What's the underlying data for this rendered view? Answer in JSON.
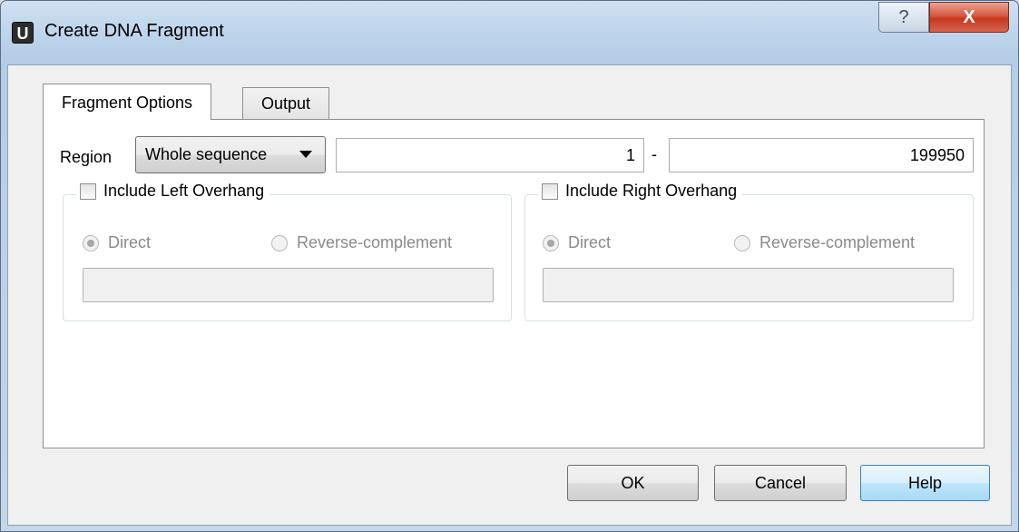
{
  "window": {
    "title": "Create DNA Fragment",
    "app_icon_letter": "U",
    "help_glyph": "?",
    "close_glyph": "X"
  },
  "tabs": [
    {
      "label": "Fragment Options",
      "active": true
    },
    {
      "label": "Output",
      "active": false
    }
  ],
  "region": {
    "label": "Region",
    "selected": "Whole sequence",
    "start": "1",
    "separator": "-",
    "end": "199950"
  },
  "left_overhang": {
    "label": "Include Left Overhang",
    "checked": false,
    "direct_label": "Direct",
    "reverse_label": "Reverse-complement",
    "selected": "Direct",
    "value": ""
  },
  "right_overhang": {
    "label": "Include Right Overhang",
    "checked": false,
    "direct_label": "Direct",
    "reverse_label": "Reverse-complement",
    "selected": "Direct",
    "value": ""
  },
  "buttons": {
    "ok": "OK",
    "cancel": "Cancel",
    "help": "Help"
  },
  "colors": {
    "title_bar": "#bcd3ea",
    "close_button": "#c5371e",
    "default_button_border": "#3c7fb1"
  }
}
